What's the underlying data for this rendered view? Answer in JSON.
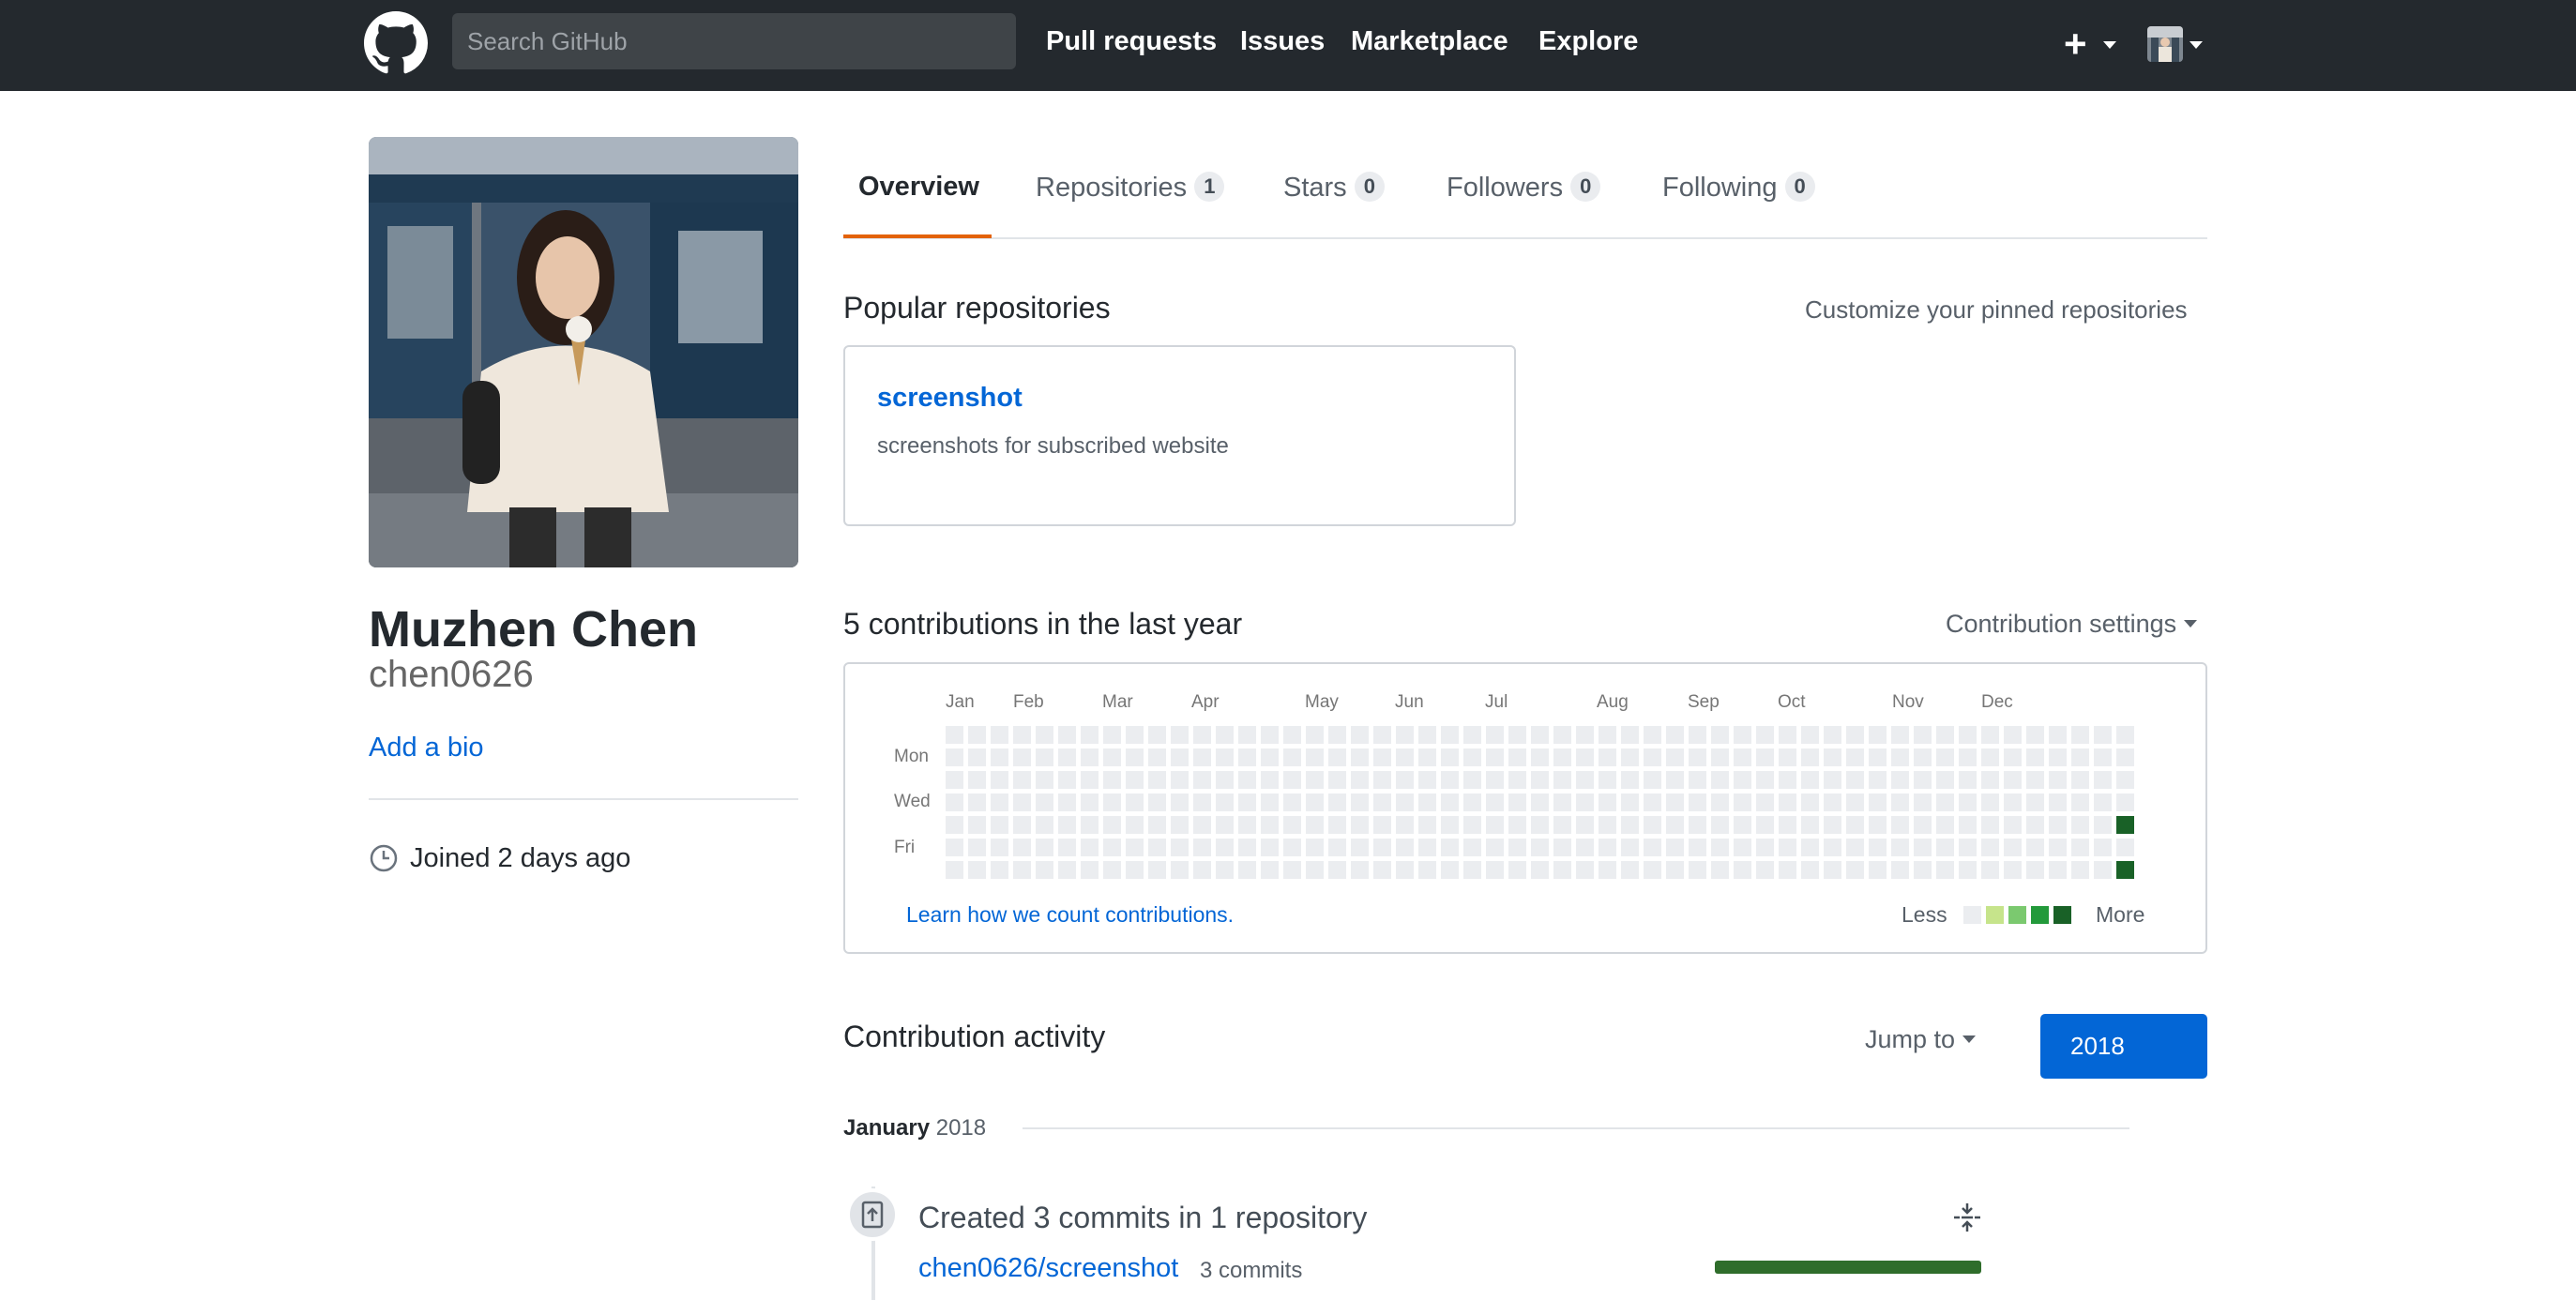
{
  "header": {
    "search_placeholder": "Search GitHub",
    "nav": [
      "Pull requests",
      "Issues",
      "Marketplace",
      "Explore"
    ],
    "plus_label": "+",
    "icons": [
      "github-logo-icon",
      "plus-icon",
      "avatar"
    ]
  },
  "profile": {
    "full_name": "Muzhen Chen",
    "username": "chen0626",
    "add_bio": "Add a bio",
    "joined": "Joined 2 days ago"
  },
  "tabs": [
    {
      "label": "Overview",
      "count": null,
      "active": true
    },
    {
      "label": "Repositories",
      "count": "1",
      "active": false
    },
    {
      "label": "Stars",
      "count": "0",
      "active": false
    },
    {
      "label": "Followers",
      "count": "0",
      "active": false
    },
    {
      "label": "Following",
      "count": "0",
      "active": false
    }
  ],
  "popular": {
    "title": "Popular repositories",
    "customize": "Customize your pinned repositories",
    "repo": {
      "name": "screenshot",
      "description": "screenshots for subscribed website"
    }
  },
  "contributions": {
    "title": "5 contributions in the last year",
    "settings": "Contribution settings",
    "months": [
      "Jan",
      "Feb",
      "Mar",
      "Apr",
      "May",
      "Jun",
      "Jul",
      "Aug",
      "Sep",
      "Oct",
      "Nov",
      "Dec"
    ],
    "days": [
      "Mon",
      "Wed",
      "Fri"
    ],
    "help": "Learn how we count contributions.",
    "legend_less": "Less",
    "legend_more": "More",
    "colors": {
      "empty": "#ebedf0",
      "l1": "#c6e48b",
      "l2": "#7bc96f",
      "l3": "#239a3b",
      "l4": "#196127"
    },
    "weeks": 53,
    "active_days": [
      {
        "week": 52,
        "weekday": 4,
        "level": 4
      },
      {
        "week": 52,
        "weekday": 6,
        "level": 4
      }
    ]
  },
  "activity": {
    "title": "Contribution activity",
    "jump_to": "Jump to",
    "year": "2018",
    "month": "January",
    "month_year": "2018",
    "commit_summary": "Created 3 commits in 1 repository",
    "commit_repo": "chen0626/screenshot",
    "commit_count": "3 commits",
    "commit_share": 1.0
  }
}
